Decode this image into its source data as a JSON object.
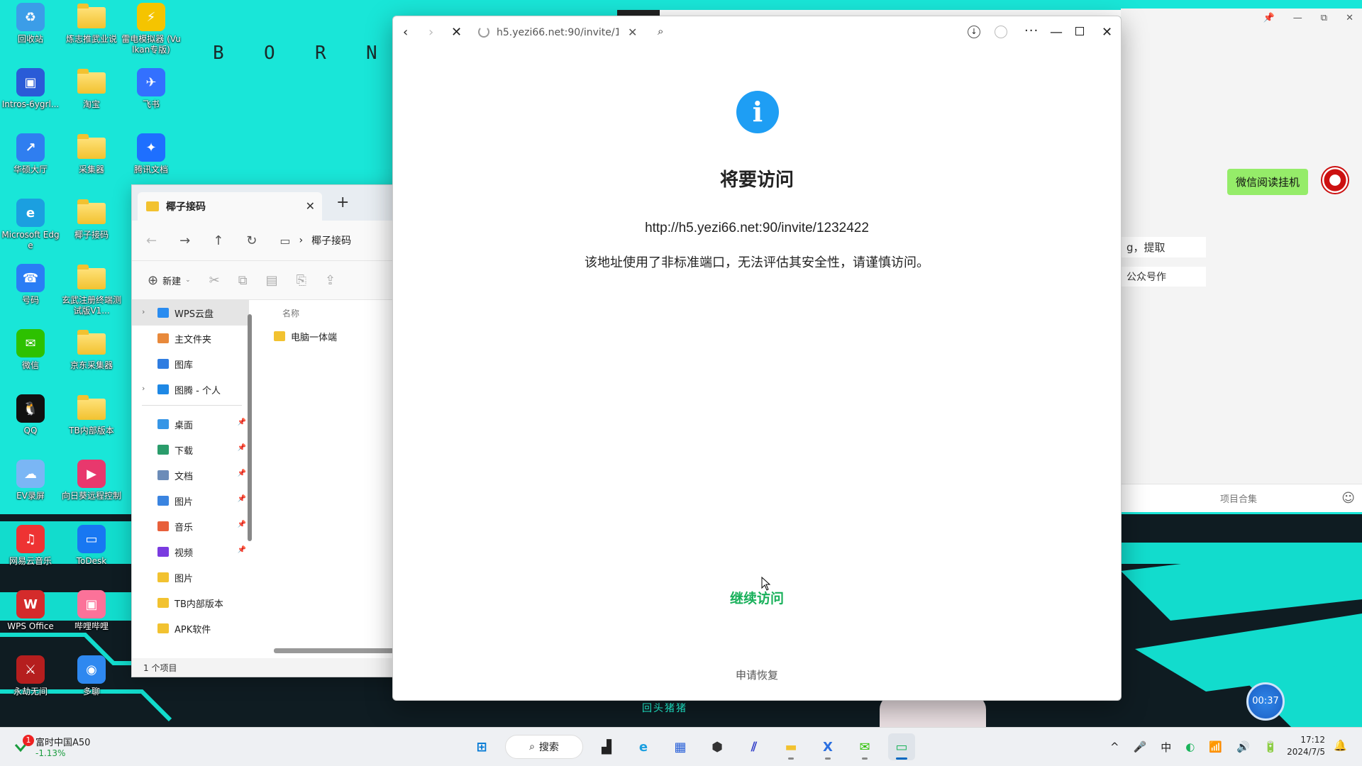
{
  "desktop": {
    "icons": [
      {
        "label": "回收站",
        "color": "#3b9de8",
        "glyph": "♻"
      },
      {
        "label": "炼志推武业说",
        "folder": true
      },
      {
        "label": "雷电模拟器 (Vulkan专版)",
        "color": "#f5c400",
        "glyph": "⚡"
      },
      {
        "label": "Intros-6ygrl...",
        "color": "#2a5bd7",
        "glyph": "▣"
      },
      {
        "label": "淘宝",
        "folder": true
      },
      {
        "label": "飞书",
        "color": "#3370ff",
        "glyph": "✈"
      },
      {
        "label": "华硕大厅",
        "color": "#2f7ef0",
        "glyph": "↗"
      },
      {
        "label": "采集器",
        "folder": true
      },
      {
        "label": "腾讯文档",
        "color": "#1e6fff",
        "glyph": "✦"
      },
      {
        "label": "Microsoft Edge",
        "color": "#1b9fe0",
        "glyph": "e"
      },
      {
        "label": "椰子接码",
        "folder": true
      },
      {
        "label": "号码",
        "color": "#2a7df5",
        "glyph": "☎"
      },
      {
        "label": "玄武注册终端测试版V1...",
        "folder": true
      },
      {
        "label": "微信",
        "color": "#2dc100",
        "glyph": "✉"
      },
      {
        "label": "京东采集器",
        "folder": true
      },
      {
        "label": "QQ",
        "color": "#111",
        "glyph": "🐧"
      },
      {
        "label": "TB内部版本",
        "folder": true
      },
      {
        "label": "EV录屏",
        "color": "#7ab6f5",
        "glyph": "☁"
      },
      {
        "label": "向日葵远程控制",
        "color": "#e8386d",
        "glyph": "▶"
      },
      {
        "label": "网易云音乐",
        "color": "#e33",
        "glyph": "♫"
      },
      {
        "label": "ToDesk",
        "color": "#1877f2",
        "glyph": "▭"
      },
      {
        "label": "WPS Office",
        "color": "#d42b2b",
        "glyph": "W"
      },
      {
        "label": "哔哩哔哩",
        "color": "#fb7299",
        "glyph": "▣"
      },
      {
        "label": "永劫无间",
        "color": "#b51e1e",
        "glyph": "⚔"
      },
      {
        "label": "多聊",
        "color": "#2e88f0",
        "glyph": "◉"
      }
    ],
    "bg_letters": [
      "B",
      "O",
      "R",
      "N"
    ]
  },
  "chat_window": {
    "controls": [
      "📌",
      "—",
      "⧉",
      "✕"
    ],
    "bubble": "微信阅读挂机",
    "text1": "g，提取",
    "text2": "公众号作",
    "bottom_label": "项目合集",
    "emoji_icon": "☺"
  },
  "explorer": {
    "tab_title": "椰子接码",
    "tab_close": "✕",
    "new_tab": "+",
    "nav": {
      "back": "←",
      "forward": "→",
      "up": "↑",
      "refresh": "↻",
      "pc": "▭",
      "sep": "›",
      "crumb": "椰子接码"
    },
    "toolbar": {
      "new_label": "新建",
      "new_icon": "⊕",
      "cut": "✂",
      "copy": "⧉",
      "paste": "▤",
      "rename": "⎘",
      "share": "⇪"
    },
    "sidebar": [
      {
        "label": "WPS云盘",
        "color": "#2a8cf0",
        "chevron": true,
        "selected": true
      },
      {
        "label": "主文件夹",
        "color": "#e8893b"
      },
      {
        "label": "图库",
        "color": "#2f7de1"
      },
      {
        "label": "图腾 - 个人",
        "color": "#1e88e5",
        "chevron": true
      },
      {
        "label": "桌面",
        "color": "#3796e6",
        "pinned": true
      },
      {
        "label": "下载",
        "color": "#2a9c6b",
        "pinned": true
      },
      {
        "label": "文档",
        "color": "#6c8cb8",
        "pinned": true
      },
      {
        "label": "图片",
        "color": "#3a84e0",
        "pinned": true
      },
      {
        "label": "音乐",
        "color": "#e8603b",
        "pinned": true
      },
      {
        "label": "视频",
        "color": "#7a3be0",
        "pinned": true
      },
      {
        "label": "图片",
        "color": "#f2c230"
      },
      {
        "label": "TB内部版本",
        "color": "#f2c230"
      },
      {
        "label": "APK软件",
        "color": "#f2c230"
      }
    ],
    "column_header": "名称",
    "files": [
      "电脑一体端"
    ],
    "status": "1 个项目"
  },
  "browser": {
    "url": "h5.yezi66.net:90/invite/1232422",
    "back": "‹",
    "forward": "›",
    "stop": "✕",
    "url_close": "✕",
    "search_icon": "⌕",
    "download_icon": "↓",
    "more_icon": "···",
    "min_icon": "—",
    "close_icon": "✕",
    "info_glyph": "i",
    "title": "将要访问",
    "link": "http://h5.yezi66.net:90/invite/1232422",
    "warning": "该地址使用了非标准端口，无法评估其安全性，请谨慎访问。",
    "continue_label": "继续访问",
    "report_label": "申请恢复"
  },
  "timer": "00:37",
  "wall_text": "回头猪猪",
  "taskbar": {
    "stock_name": "富时中国A50",
    "stock_change": "-1.13%",
    "stock_badge": "1",
    "search_label": "搜索",
    "search_icon": "⌕",
    "apps": [
      {
        "name": "start",
        "glyph": "⊞",
        "color": "#0078d4"
      },
      {
        "name": "search"
      },
      {
        "name": "task-view",
        "glyph": "▟",
        "color": "#222"
      },
      {
        "name": "edge",
        "glyph": "e",
        "color": "#1b9fe0"
      },
      {
        "name": "store",
        "glyph": "▦",
        "color": "#2860d8"
      },
      {
        "name": "cube-app",
        "glyph": "⬢",
        "color": "#333"
      },
      {
        "name": "ai-app",
        "glyph": "⫽",
        "color": "#3340c9"
      },
      {
        "name": "file-explorer",
        "glyph": "▬",
        "color": "#f2c230",
        "running": true
      },
      {
        "name": "lx-app",
        "glyph": "X",
        "color": "#2a6fe0",
        "running": true
      },
      {
        "name": "wechat",
        "glyph": "✉",
        "color": "#2dc100",
        "running": true
      },
      {
        "name": "remote-app",
        "glyph": "▭",
        "color": "#19b35a",
        "running": true,
        "active": true
      }
    ],
    "tray": [
      "^",
      "🎤",
      "中",
      "◐",
      "📶",
      "🔊",
      "🔋"
    ],
    "time": "17:12",
    "date": "2024/7/5",
    "bell": "🔔"
  }
}
